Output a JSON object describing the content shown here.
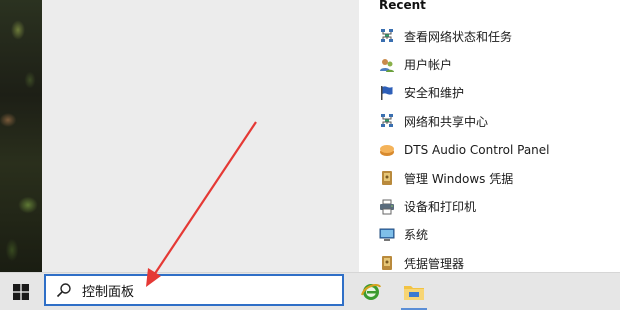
{
  "start_menu": {
    "recent_heading": "Recent",
    "recent_items": [
      {
        "label": "查看网络状态和任务",
        "icon": "network-status-icon"
      },
      {
        "label": "用户帐户",
        "icon": "user-accounts-icon"
      },
      {
        "label": "安全和维护",
        "icon": "security-flag-icon"
      },
      {
        "label": "网络和共享中心",
        "icon": "network-sharing-icon"
      },
      {
        "label": "DTS Audio Control Panel",
        "icon": "dts-audio-icon"
      },
      {
        "label": "管理 Windows 凭据",
        "icon": "credential-vault-icon"
      },
      {
        "label": "设备和打印机",
        "icon": "devices-printers-icon"
      },
      {
        "label": "系统",
        "icon": "system-monitor-icon"
      },
      {
        "label": "凭据管理器",
        "icon": "credential-manager-icon"
      }
    ]
  },
  "taskbar": {
    "search": {
      "value": "控制面板",
      "icon": "search-icon"
    },
    "start_icon": "windows-logo-icon",
    "apps": [
      {
        "name": "internet-explorer-icon",
        "pinned": true
      },
      {
        "name": "file-explorer-icon",
        "pinned": true,
        "running": true
      }
    ]
  },
  "colors": {
    "accent": "#2f6fc7",
    "annotation_arrow": "#e53935"
  }
}
